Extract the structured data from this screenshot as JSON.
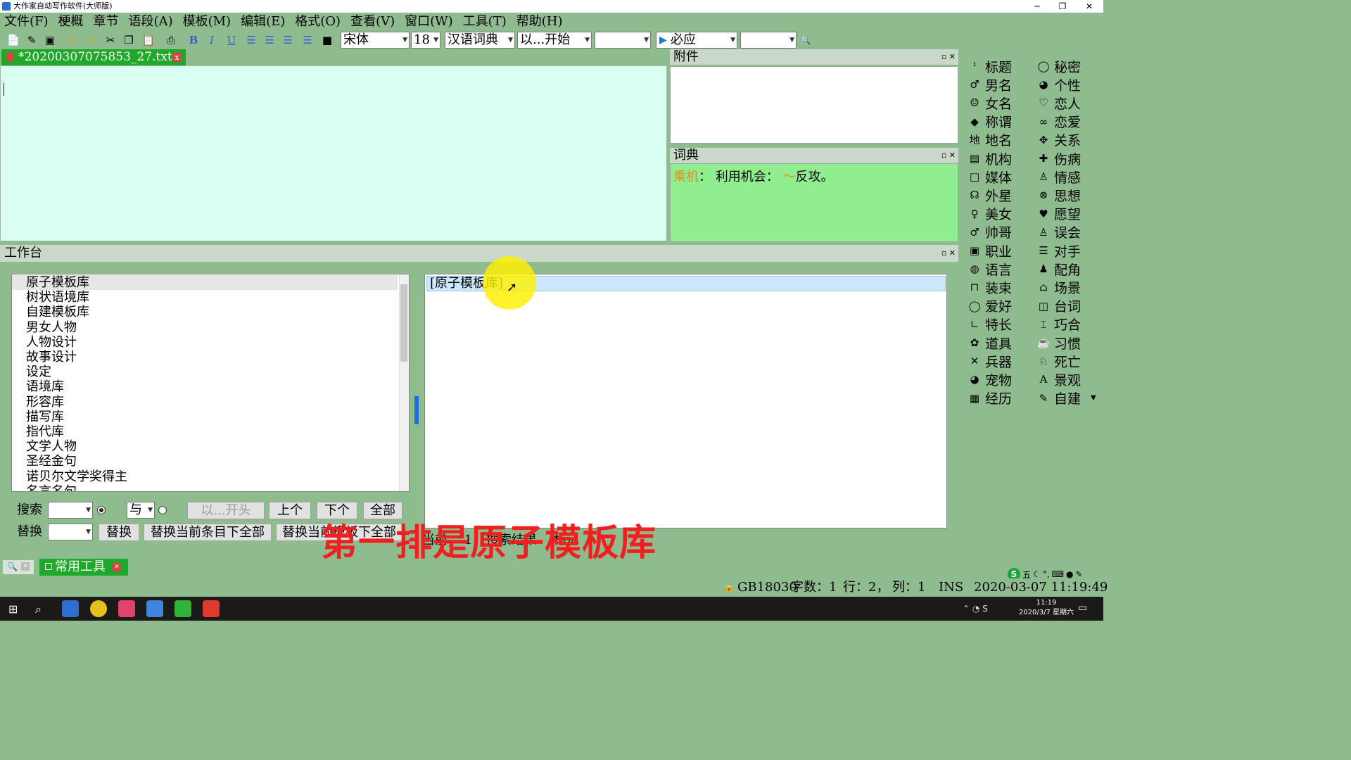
{
  "window": {
    "title": "大作家自动写作软件(大师版)",
    "min": "─",
    "max": "❐",
    "close": "✕"
  },
  "menu": [
    "文件(F)",
    "梗概",
    "章节",
    "语段(A)",
    "模板(M)",
    "编辑(E)",
    "格式(O)",
    "查看(V)",
    "窗口(W)",
    "工具(T)",
    "帮助(H)"
  ],
  "toolbar": {
    "font": "宋体",
    "size": "18",
    "dict": "汉语词典",
    "match": "以...开始",
    "blank1": "",
    "mode": "必应",
    "blank2": "",
    "bold": "B",
    "italic": "I",
    "underline": "U"
  },
  "document_tab": {
    "name": "*20200307075853_27.txt",
    "close": "x"
  },
  "attachment_panel": {
    "title": "附件"
  },
  "dictionary_panel": {
    "title": "词典",
    "word": "乘机",
    "sep": "：",
    "definition": "利用机会：",
    "example_tilde": "～",
    "example": "反攻。"
  },
  "palette": {
    "left": [
      "标题",
      "男名",
      "女名",
      "称谓",
      "地名",
      "机构",
      "媒体",
      "外星",
      "美女",
      "帅哥",
      "职业",
      "语言",
      "装束",
      "爱好",
      "特长",
      "道具",
      "兵器",
      "宠物",
      "经历"
    ],
    "right": [
      "秘密",
      "个性",
      "恋人",
      "恋爱",
      "关系",
      "伤病",
      "情感",
      "思想",
      "愿望",
      "误会",
      "对手",
      "配角",
      "场景",
      "台词",
      "巧合",
      "习惯",
      "死亡",
      "景观",
      "自建"
    ],
    "left_icons": [
      "title-icon",
      "male-name-icon",
      "female-name-icon",
      "tag-icon",
      "map-icon",
      "building-icon",
      "square-icon",
      "alien-icon",
      "female-icon",
      "male-icon",
      "id-card-icon",
      "globe-icon",
      "clothes-icon",
      "hobby-icon",
      "skill-icon",
      "gear-icon",
      "sword-icon",
      "pet-icon",
      "book-icon"
    ],
    "right_icons": [
      "secret-icon",
      "palette-icon",
      "heart-outline-icon",
      "couple-icon",
      "relation-icon",
      "injury-icon",
      "emotion-icon",
      "thought-icon",
      "heart-icon",
      "person-icon",
      "rival-icon",
      "supporting-icon",
      "house-icon",
      "speech-icon",
      "coincidence-icon",
      "habit-icon",
      "death-icon",
      "scenery-icon",
      "custom-icon"
    ]
  },
  "workbench": {
    "title": "工作台",
    "tree": [
      "原子模板库",
      "树状语境库",
      "自建模板库",
      "男女人物",
      "人物设计",
      "故事设计",
      "设定",
      "语境库",
      "形容库",
      "描写库",
      "指代库",
      "文学人物",
      "圣经金句",
      "诺贝尔文学奖得主",
      "名言名句"
    ],
    "result_row": "[原子模板库]",
    "search_label": "搜索",
    "and_label": "与",
    "begin_label": "以...开头",
    "prev": "上个",
    "next": "下个",
    "all": "全部",
    "replace_label": "替换",
    "replace_btn": "替换",
    "replace_all_under": "替换当前条目下全部",
    "replace_template_all": "替换当前模板下全部",
    "status_current": "当前",
    "status_count": "1",
    "status_results": "搜索结果",
    "status_tail": "标记"
  },
  "bottom_tabs": {
    "tools": "常用工具"
  },
  "statusbar": {
    "encoding": "GB18030",
    "chars": "字数：1",
    "line": "行：2，",
    "col": "列：1",
    "ins": "INS",
    "datetime": "2020-03-07 11:19:49"
  },
  "ime": {
    "brand": "S",
    "mode": "五"
  },
  "taskbar": {
    "time": "11:19",
    "date": "2020/3/7 星期六"
  },
  "caption": "第一排是原子模板库",
  "colors": {
    "background": "#8fbc8f",
    "editor": "#d8fff1",
    "dictionary": "#90ee90",
    "tab": "#1fa82a",
    "caption": "#f02020"
  }
}
